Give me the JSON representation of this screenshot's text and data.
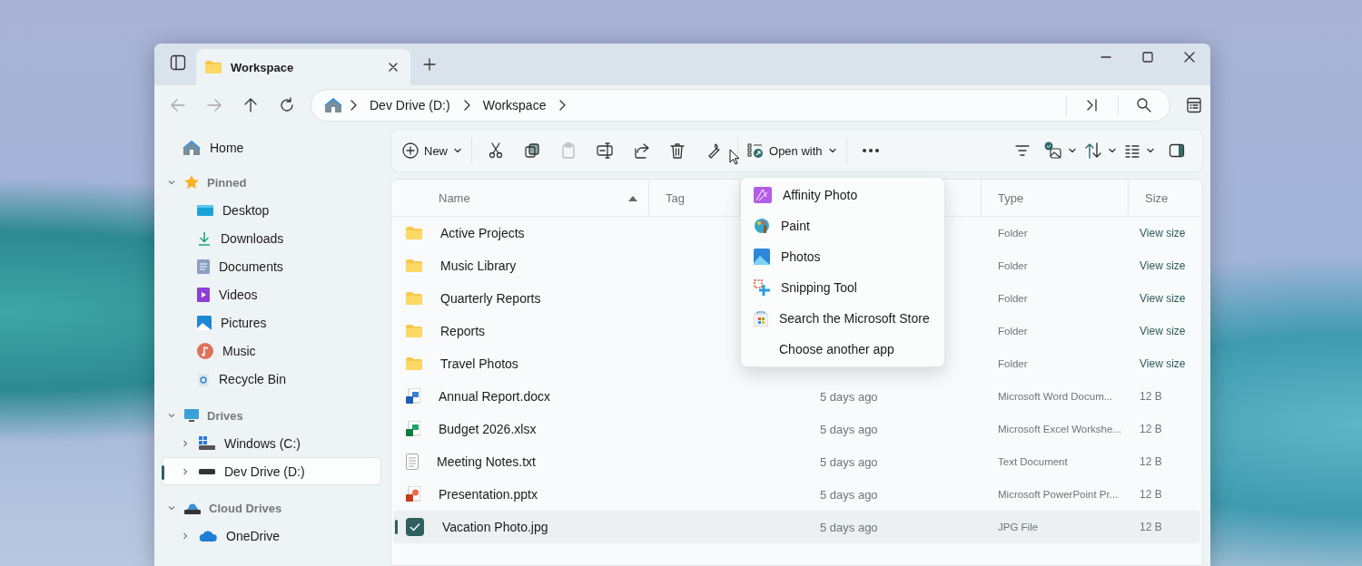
{
  "window": {
    "tabs": [
      {
        "label": "Workspace",
        "selected": true
      }
    ]
  },
  "address_bar": {
    "crumbs": [
      "Dev Drive (D:)",
      "Workspace"
    ]
  },
  "sidebar": {
    "home": {
      "label": "Home",
      "selected": false
    },
    "sections": [
      {
        "label": "Pinned",
        "kind": "star",
        "expanded": true,
        "children": [
          {
            "label": "Desktop",
            "kind": "desktop",
            "selected": false
          },
          {
            "label": "Downloads",
            "kind": "downloads",
            "selected": false
          },
          {
            "label": "Documents",
            "kind": "documents",
            "selected": false
          },
          {
            "label": "Videos",
            "kind": "videos",
            "selected": false
          },
          {
            "label": "Pictures",
            "kind": "pictures",
            "selected": false
          },
          {
            "label": "Music",
            "kind": "music",
            "selected": false
          },
          {
            "label": "Recycle Bin",
            "kind": "recycle",
            "selected": false
          }
        ]
      },
      {
        "label": "Drives",
        "kind": "monitor",
        "expanded": true,
        "children": [
          {
            "label": "Windows (C:)",
            "kind": "windrive",
            "selected": false,
            "expanded": false
          },
          {
            "label": "Dev Drive (D:)",
            "kind": "drive",
            "selected": true,
            "expanded": false
          }
        ]
      },
      {
        "label": "Cloud Drives",
        "kind": "cloud",
        "expanded": true,
        "children": [
          {
            "label": "OneDrive",
            "kind": "onedrive",
            "selected": false,
            "expanded": false
          }
        ]
      }
    ]
  },
  "toolbar": {
    "new_label": "New",
    "open_with_label": "Open with"
  },
  "table": {
    "columns": [
      {
        "label": "Name",
        "sorted": true
      },
      {
        "label": "Tag",
        "sorted": false
      },
      {
        "label": "Type",
        "sorted": false
      },
      {
        "label": "Size",
        "sorted": false
      }
    ],
    "rows": [
      {
        "name": "Active Projects",
        "kind": "folder",
        "type": "Folder",
        "size": "View size",
        "selected": false
      },
      {
        "name": "Music Library",
        "kind": "folder",
        "type": "Folder",
        "size": "View size",
        "selected": false
      },
      {
        "name": "Quarterly Reports",
        "kind": "folder",
        "type": "Folder",
        "size": "View size",
        "selected": false
      },
      {
        "name": "Reports",
        "kind": "folder",
        "type": "Folder",
        "size": "View size",
        "selected": false
      },
      {
        "name": "Travel Photos",
        "kind": "folder",
        "type": "Folder",
        "size": "View size",
        "selected": false
      },
      {
        "name": "Annual Report.docx",
        "kind": "word",
        "date": "5 days ago",
        "type": "Microsoft Word Docum...",
        "size": "12 B",
        "selected": false
      },
      {
        "name": "Budget 2026.xlsx",
        "kind": "excel",
        "date": "5 days ago",
        "type": "Microsoft Excel Workshe...",
        "size": "12 B",
        "selected": false
      },
      {
        "name": "Meeting Notes.txt",
        "kind": "text",
        "date": "5 days ago",
        "type": "Text Document",
        "size": "12 B",
        "selected": false
      },
      {
        "name": "Presentation.pptx",
        "kind": "powerpoint",
        "date": "5 days ago",
        "type": "Microsoft PowerPoint Pr...",
        "size": "12 B",
        "selected": false
      },
      {
        "name": "Vacation Photo.jpg",
        "kind": "image",
        "date": "5 days ago",
        "type": "JPG File",
        "size": "12 B",
        "selected": true
      }
    ]
  },
  "open_with_menu": {
    "items": [
      {
        "label": "Affinity Photo",
        "kind": "affinity"
      },
      {
        "label": "Paint",
        "kind": "paint"
      },
      {
        "label": "Photos",
        "kind": "photos"
      },
      {
        "label": "Snipping Tool",
        "kind": "snipping"
      },
      {
        "label": "Search the Microsoft Store",
        "kind": "store"
      },
      {
        "label": "Choose another app",
        "kind": "plain"
      }
    ]
  }
}
